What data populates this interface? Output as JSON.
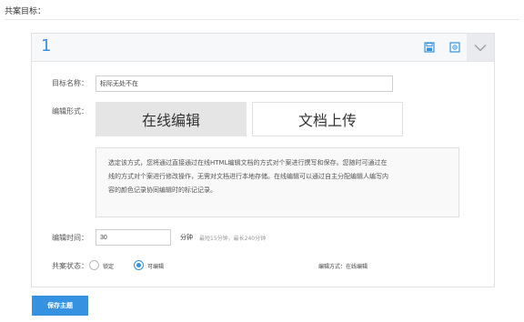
{
  "page": {
    "title": "共案目标："
  },
  "card": {
    "number": "1",
    "header_icons": {
      "save": "save-icon",
      "preview": "preview-icon",
      "collapse": "chevron-down-icon"
    },
    "target_name": {
      "label": "目标名称：",
      "value": "标际无处不在"
    },
    "edit_mode": {
      "label": "编辑形式：",
      "tabs": [
        {
          "label": "在线编辑",
          "selected": true
        },
        {
          "label": "文档上传",
          "selected": false
        }
      ],
      "description_lines": [
        "选定该方式，您将通过直接通过在线HTML编辑文档的方式对个案进行撰写和保存。您随时可通过在",
        "线的方式对个案进行修改操作，无需对文档进行本地存储。在线编辑可以通过自主分配编辑人编写内",
        "容的颜色记录协同编辑时的标记记录。"
      ]
    },
    "edit_time": {
      "label": "编辑时间：",
      "value": "30",
      "unit": "分钟",
      "hint": "最短15分钟，最长240分钟"
    },
    "share_status": {
      "label": "共案状态：",
      "options": [
        {
          "label": "锁定",
          "checked": false
        },
        {
          "label": "可编辑",
          "checked": true
        }
      ],
      "mode_text": "编辑方式：在线编辑"
    }
  },
  "actions": {
    "save_label": "保存主题"
  },
  "colors": {
    "accent": "#3592e0",
    "tab_selected_bg": "#e5e5e5",
    "header_bg": "#f7f8f9"
  }
}
